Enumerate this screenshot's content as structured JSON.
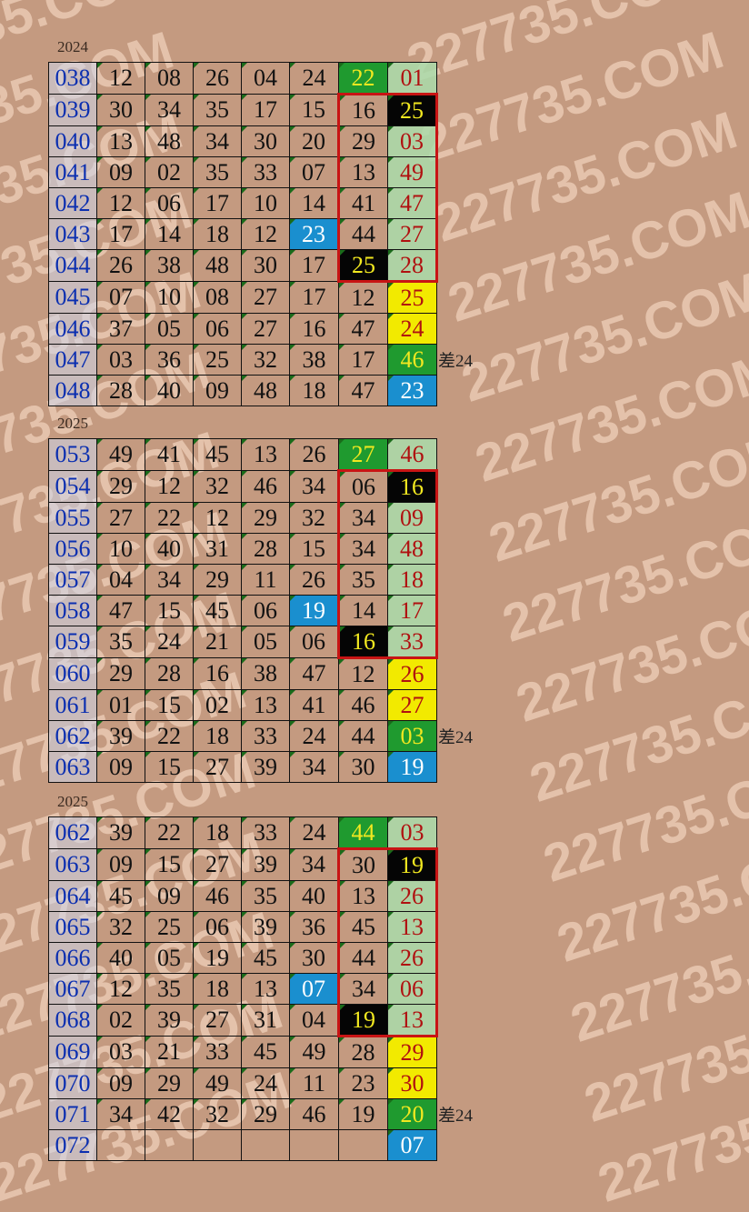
{
  "watermark": "227735.COM",
  "sections": [
    {
      "year": "2024",
      "note": "差24",
      "rows": [
        {
          "id": "038",
          "nums": [
            "12",
            "08",
            "26",
            "04",
            "24",
            "22",
            "01"
          ]
        },
        {
          "id": "039",
          "nums": [
            "30",
            "34",
            "35",
            "17",
            "15",
            "16",
            "25"
          ]
        },
        {
          "id": "040",
          "nums": [
            "13",
            "48",
            "34",
            "30",
            "20",
            "29",
            "03"
          ]
        },
        {
          "id": "041",
          "nums": [
            "09",
            "02",
            "35",
            "33",
            "07",
            "13",
            "49"
          ]
        },
        {
          "id": "042",
          "nums": [
            "12",
            "06",
            "17",
            "10",
            "14",
            "41",
            "47"
          ]
        },
        {
          "id": "043",
          "nums": [
            "17",
            "14",
            "18",
            "12",
            "23",
            "44",
            "27"
          ]
        },
        {
          "id": "044",
          "nums": [
            "26",
            "38",
            "48",
            "30",
            "17",
            "25",
            "28"
          ]
        },
        {
          "id": "045",
          "nums": [
            "07",
            "10",
            "08",
            "27",
            "17",
            "12",
            "25"
          ]
        },
        {
          "id": "046",
          "nums": [
            "37",
            "05",
            "06",
            "27",
            "16",
            "47",
            "24"
          ]
        },
        {
          "id": "047",
          "nums": [
            "03",
            "36",
            "25",
            "32",
            "38",
            "17",
            "46"
          ]
        },
        {
          "id": "048",
          "nums": [
            "28",
            "40",
            "09",
            "48",
            "18",
            "47",
            "23"
          ]
        }
      ]
    },
    {
      "year": "2025",
      "note": "差24",
      "rows": [
        {
          "id": "053",
          "nums": [
            "49",
            "41",
            "45",
            "13",
            "26",
            "27",
            "46"
          ]
        },
        {
          "id": "054",
          "nums": [
            "29",
            "12",
            "32",
            "46",
            "34",
            "06",
            "16"
          ]
        },
        {
          "id": "055",
          "nums": [
            "27",
            "22",
            "12",
            "29",
            "32",
            "34",
            "09"
          ]
        },
        {
          "id": "056",
          "nums": [
            "10",
            "40",
            "31",
            "28",
            "15",
            "34",
            "48"
          ]
        },
        {
          "id": "057",
          "nums": [
            "04",
            "34",
            "29",
            "11",
            "26",
            "35",
            "18"
          ]
        },
        {
          "id": "058",
          "nums": [
            "47",
            "15",
            "45",
            "06",
            "19",
            "14",
            "17"
          ]
        },
        {
          "id": "059",
          "nums": [
            "35",
            "24",
            "21",
            "05",
            "06",
            "16",
            "33"
          ]
        },
        {
          "id": "060",
          "nums": [
            "29",
            "28",
            "16",
            "38",
            "47",
            "12",
            "26"
          ]
        },
        {
          "id": "061",
          "nums": [
            "01",
            "15",
            "02",
            "13",
            "41",
            "46",
            "27"
          ]
        },
        {
          "id": "062",
          "nums": [
            "39",
            "22",
            "18",
            "33",
            "24",
            "44",
            "03"
          ]
        },
        {
          "id": "063",
          "nums": [
            "09",
            "15",
            "27",
            "39",
            "34",
            "30",
            "19"
          ]
        }
      ]
    },
    {
      "year": "2025",
      "note": "差24",
      "rows": [
        {
          "id": "062",
          "nums": [
            "39",
            "22",
            "18",
            "33",
            "24",
            "44",
            "03"
          ]
        },
        {
          "id": "063",
          "nums": [
            "09",
            "15",
            "27",
            "39",
            "34",
            "30",
            "19"
          ]
        },
        {
          "id": "064",
          "nums": [
            "45",
            "09",
            "46",
            "35",
            "40",
            "13",
            "26"
          ]
        },
        {
          "id": "065",
          "nums": [
            "32",
            "25",
            "06",
            "39",
            "36",
            "45",
            "13"
          ]
        },
        {
          "id": "066",
          "nums": [
            "40",
            "05",
            "19",
            "45",
            "30",
            "44",
            "26"
          ]
        },
        {
          "id": "067",
          "nums": [
            "12",
            "35",
            "18",
            "13",
            "07",
            "34",
            "06"
          ]
        },
        {
          "id": "068",
          "nums": [
            "02",
            "39",
            "27",
            "31",
            "04",
            "19",
            "13"
          ]
        },
        {
          "id": "069",
          "nums": [
            "03",
            "21",
            "33",
            "45",
            "49",
            "28",
            "29"
          ]
        },
        {
          "id": "070",
          "nums": [
            "09",
            "29",
            "49",
            "24",
            "11",
            "23",
            "30"
          ]
        },
        {
          "id": "071",
          "nums": [
            "34",
            "42",
            "32",
            "29",
            "46",
            "19",
            "20"
          ]
        },
        {
          "id": "072",
          "nums": [
            "",
            "",
            "",
            "",
            "",
            "",
            "07"
          ]
        }
      ]
    }
  ],
  "colors": {
    "green": "#1f9a2f",
    "black": "#050505",
    "blue": "#1a8fcf",
    "yellow": "#f2ea00",
    "red_border": "#c81414"
  }
}
